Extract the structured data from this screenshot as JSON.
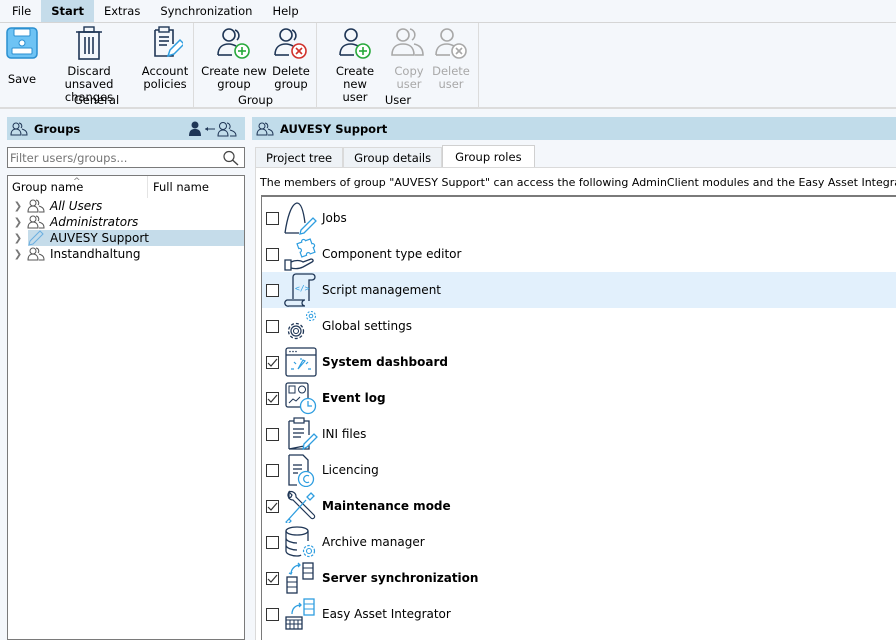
{
  "menu": {
    "items": [
      "File",
      "Start",
      "Extras",
      "Synchronization",
      "Help"
    ],
    "active": "Start"
  },
  "ribbon": {
    "groups": [
      {
        "label": "General",
        "buttons": [
          {
            "label": "Save",
            "icon": "save-icon",
            "enabled": true
          },
          {
            "label": "Discard\nunsaved changes",
            "icon": "trash-icon",
            "enabled": true
          },
          {
            "label": "Account\npolicies",
            "icon": "clipboard-edit-icon",
            "enabled": true
          }
        ]
      },
      {
        "label": "Group",
        "buttons": [
          {
            "label": "Create new\ngroup",
            "icon": "group-add-icon",
            "enabled": true
          },
          {
            "label": "Delete\ngroup",
            "icon": "group-delete-icon",
            "enabled": true
          }
        ]
      },
      {
        "label": "User",
        "buttons": [
          {
            "label": "Create new\nuser",
            "icon": "user-add-icon",
            "enabled": true
          },
          {
            "label": "Copy\nuser",
            "icon": "user-copy-icon",
            "enabled": false
          },
          {
            "label": "Delete\nuser",
            "icon": "user-delete-icon",
            "enabled": false
          }
        ]
      }
    ]
  },
  "groups_pane": {
    "title": "Groups",
    "filter_placeholder": "Filter users/groups...",
    "columns": [
      "Group name",
      "Full name"
    ],
    "rows": [
      {
        "name": "All Users",
        "italic": true,
        "icon": "group-icon",
        "selected": false
      },
      {
        "name": "Administrators",
        "italic": true,
        "icon": "group-icon",
        "selected": false
      },
      {
        "name": "AUVESY Support",
        "italic": false,
        "icon": "pencil-icon",
        "selected": true
      },
      {
        "name": "Instandhaltung",
        "italic": false,
        "icon": "group-icon",
        "selected": false
      }
    ]
  },
  "detail_pane": {
    "title": "AUVESY Support",
    "tabs": [
      "Project tree",
      "Group details",
      "Group roles"
    ],
    "active_tab": "Group roles",
    "description": "The members of group \"AUVESY Support\" can access the following AdminClient modules and the Easy Asset Integrator:",
    "roles": [
      {
        "label": "Jobs",
        "checked": false,
        "icon": "jobs-icon"
      },
      {
        "label": "Component type editor",
        "checked": false,
        "icon": "component-type-icon"
      },
      {
        "label": "Script management",
        "checked": false,
        "icon": "script-icon",
        "hover": true
      },
      {
        "label": "Global settings",
        "checked": false,
        "icon": "gear-icon"
      },
      {
        "label": "System dashboard",
        "checked": true,
        "icon": "dashboard-icon"
      },
      {
        "label": "Event log",
        "checked": true,
        "icon": "event-log-icon"
      },
      {
        "label": "INI files",
        "checked": false,
        "icon": "ini-file-icon"
      },
      {
        "label": "Licencing",
        "checked": false,
        "icon": "licence-icon"
      },
      {
        "label": "Maintenance mode",
        "checked": true,
        "icon": "maintenance-icon"
      },
      {
        "label": "Archive manager",
        "checked": false,
        "icon": "archive-icon"
      },
      {
        "label": "Server synchronization",
        "checked": true,
        "icon": "server-sync-icon"
      },
      {
        "label": "Easy Asset Integrator",
        "checked": false,
        "icon": "asset-integrator-icon"
      }
    ]
  },
  "colors": {
    "header_bg": "#c1dcea",
    "selected_bg": "#c5dcea",
    "hover_bg": "#e2f0fc",
    "icon_dark": "#1f3656",
    "icon_accent": "#2f9ee0",
    "add_green": "#26a83a",
    "delete_red": "#d0302a"
  }
}
